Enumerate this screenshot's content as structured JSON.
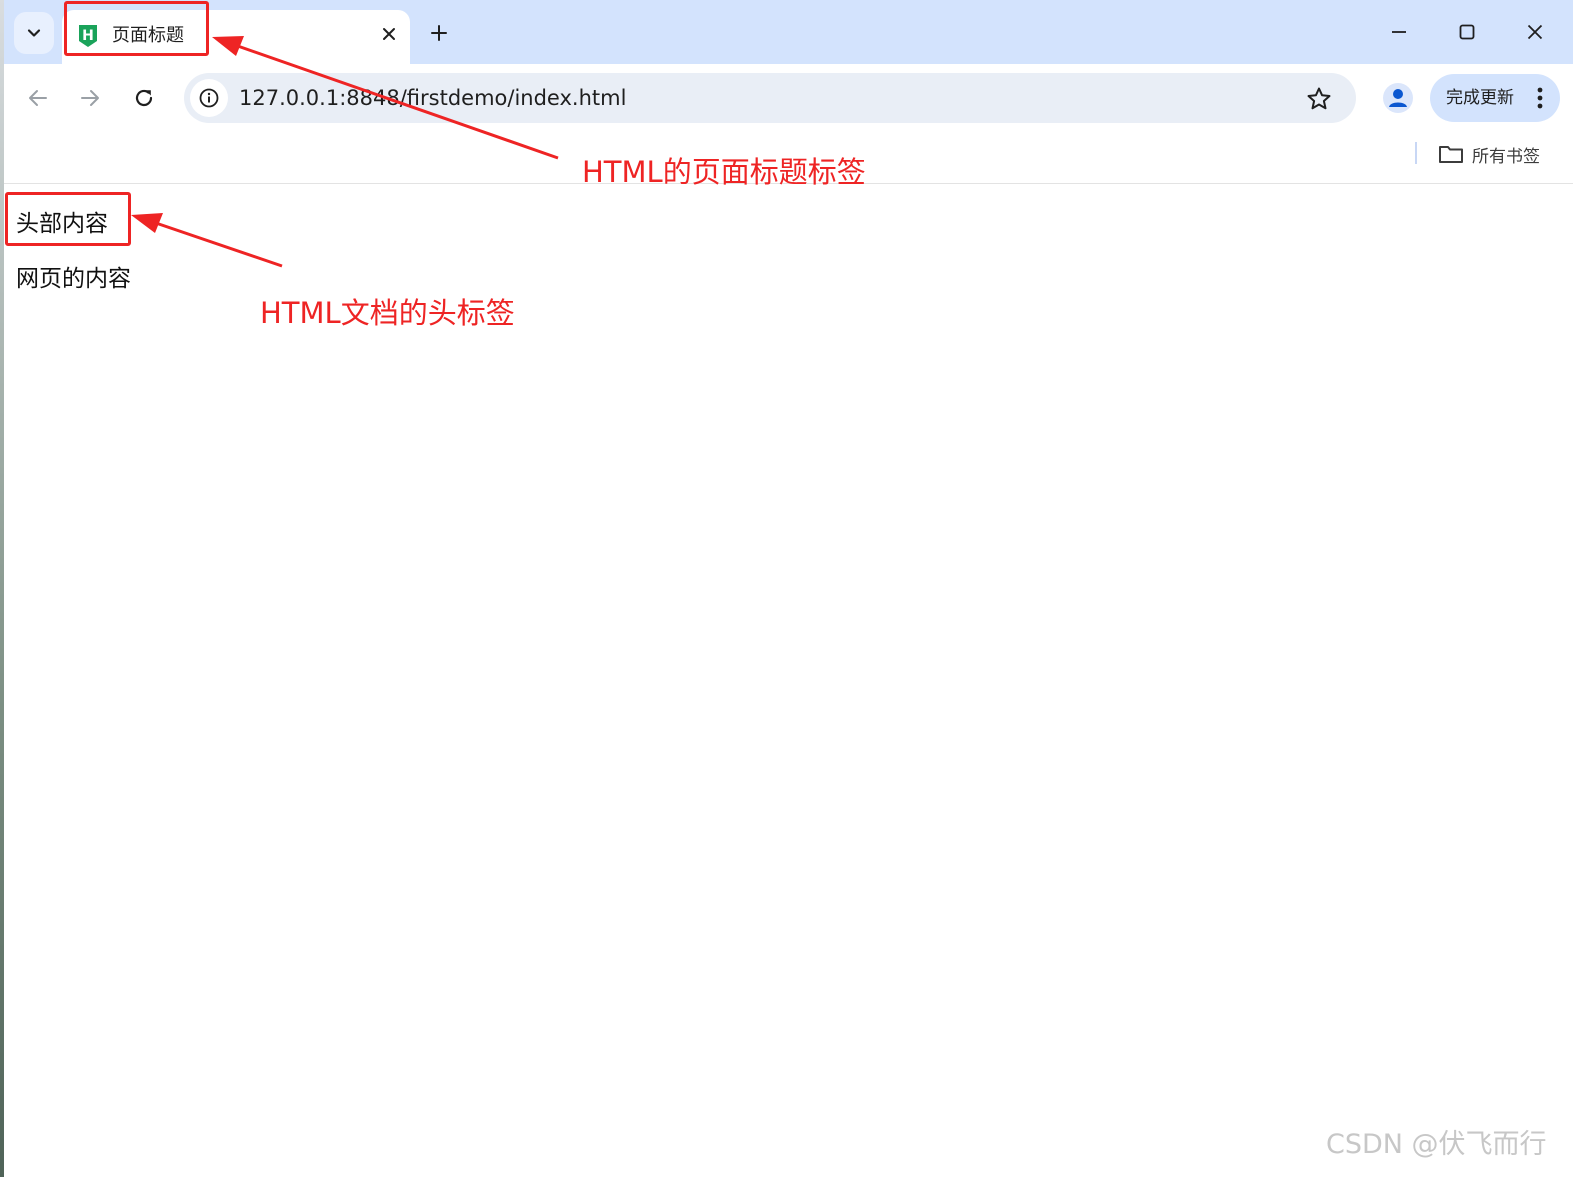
{
  "tab": {
    "title": "页面标题",
    "favicon_letter": "H",
    "favicon_color": "#1aa35a"
  },
  "toolbar": {
    "url": "127.0.0.1:8848/firstdemo/index.html",
    "update_label": "完成更新"
  },
  "bookmarks": {
    "all_label": "所有书签"
  },
  "page": {
    "header_text": "头部内容",
    "body_text": "网页的内容"
  },
  "annotations": {
    "title_tag": "HTML的页面标题标签",
    "head_tag": "HTML文档的头标签",
    "color": "#ee2424"
  },
  "watermark": "CSDN @伏飞而行",
  "icons": {
    "tab_search": "chevron-down-icon",
    "close": "close-icon",
    "new_tab": "plus-icon",
    "back": "arrow-left-icon",
    "forward": "arrow-right-icon",
    "reload": "reload-icon",
    "info": "info-icon",
    "star": "star-icon",
    "profile": "person-icon",
    "menu": "kebab-menu-icon",
    "folder": "folder-icon"
  }
}
